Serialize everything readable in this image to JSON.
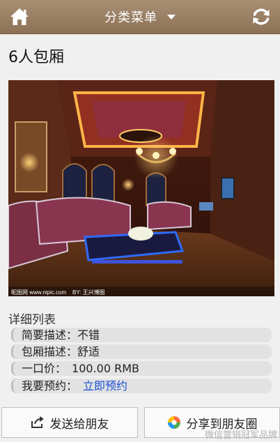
{
  "header": {
    "menu_title": "分类菜单",
    "home_icon": "home-icon",
    "refresh_icon": "refresh-icon",
    "bar_color": "#9a7f63"
  },
  "room": {
    "title": "6人包厢",
    "photo_caption_left": "昵图网 www.nipic.com",
    "photo_caption_mid": "BY: 王兴博图"
  },
  "details": {
    "heading": "详细列表",
    "rows": [
      {
        "label": "简要描述：",
        "value": "不错"
      },
      {
        "label": "包厢描述：",
        "value": "舒适"
      },
      {
        "label": "一口价：",
        "value": "100.00 RMB"
      },
      {
        "label": "我要预约：",
        "value": "立即预约"
      }
    ],
    "link_color": "#1a4fd6"
  },
  "actions": {
    "send_label": "发送给朋友",
    "share_label": "分享到朋友圈"
  },
  "watermark": "微信营销冠军品牌"
}
